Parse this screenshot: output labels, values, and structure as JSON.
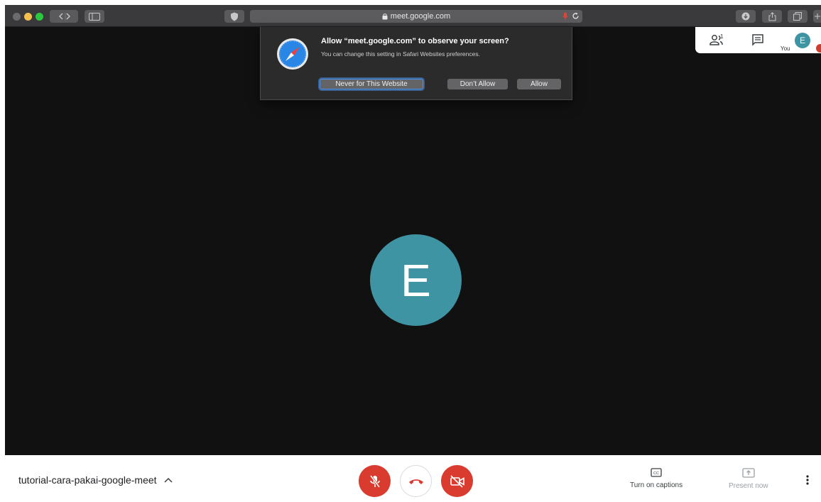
{
  "browser": {
    "url": "meet.google.com"
  },
  "permission_dialog": {
    "title": "Allow “meet.google.com” to observe your screen?",
    "subtitle": "You can change this setting in Safari Websites preferences.",
    "buttons": {
      "never": "Never for This Website",
      "dont_allow": "Don’t Allow",
      "allow": "Allow"
    }
  },
  "participants": {
    "count": "1",
    "self_label": "You",
    "self_initial": "E"
  },
  "stage": {
    "avatar_initial": "E"
  },
  "bottom_bar": {
    "meeting_name": "tutorial-cara-pakai-google-meet",
    "captions_label": "Turn on captions",
    "present_label": "Present now"
  },
  "colors": {
    "avatar": "#3e94a3",
    "danger": "#d93b2e",
    "stage_bg": "#111111"
  },
  "icons": {
    "safari": "compass-icon",
    "people": "people-icon",
    "chat": "chat-icon",
    "mic_off": "mic-off-icon",
    "hangup": "phone-hangup-icon",
    "camera_off": "camera-off-icon",
    "captions": "closed-captions-icon",
    "present": "present-screen-icon",
    "more": "more-vert-icon"
  }
}
